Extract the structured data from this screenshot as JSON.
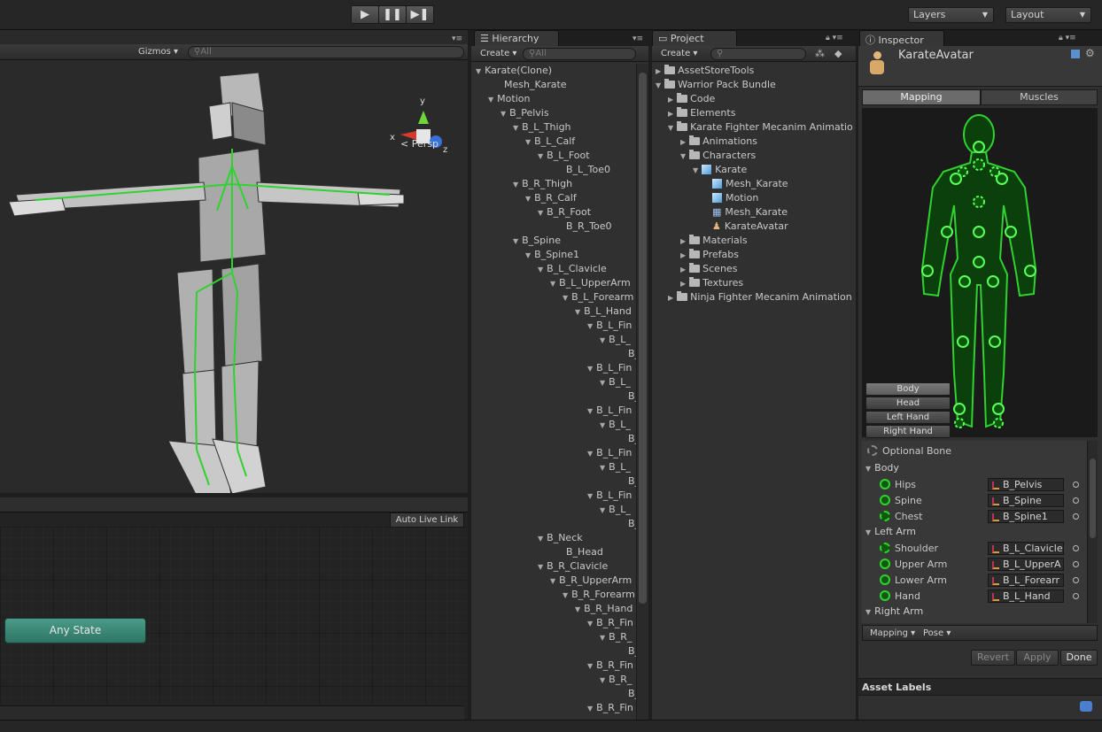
{
  "toolbar": {
    "play_icon": "play-icon",
    "pause_icon": "pause-icon",
    "step_icon": "step-icon",
    "layers_label": "Layers",
    "layout_label": "Layout"
  },
  "scene": {
    "gizmos_label": "Gizmos",
    "search_placeholder": "All",
    "persp_label": "Persp",
    "axis_y": "y",
    "axis_x": "x",
    "axis_z": "z"
  },
  "animator": {
    "auto_live_link": "Auto Live Link",
    "any_state": "Any State"
  },
  "hierarchy": {
    "tab": "Hierarchy",
    "create": "Create",
    "search_placeholder": "All",
    "items": [
      {
        "label": "Karate(Clone)",
        "arrow": "▼"
      },
      {
        "label": "Mesh_Karate",
        "arrow": ""
      },
      {
        "label": "Motion",
        "arrow": "▼"
      },
      {
        "label": "B_Pelvis",
        "arrow": "▼"
      },
      {
        "label": "B_L_Thigh",
        "arrow": "▼"
      },
      {
        "label": "B_L_Calf",
        "arrow": "▼"
      },
      {
        "label": "B_L_Foot",
        "arrow": "▼"
      },
      {
        "label": "B_L_Toe0",
        "arrow": ""
      },
      {
        "label": "B_R_Thigh",
        "arrow": "▼"
      },
      {
        "label": "B_R_Calf",
        "arrow": "▼"
      },
      {
        "label": "B_R_Foot",
        "arrow": "▼"
      },
      {
        "label": "B_R_Toe0",
        "arrow": ""
      },
      {
        "label": "B_Spine",
        "arrow": "▼"
      },
      {
        "label": "B_Spine1",
        "arrow": "▼"
      },
      {
        "label": "B_L_Clavicle",
        "arrow": "▼"
      },
      {
        "label": "B_L_UpperArm",
        "arrow": "▼"
      },
      {
        "label": "B_L_Forearm",
        "arrow": "▼"
      },
      {
        "label": "B_L_Hand",
        "arrow": "▼"
      },
      {
        "label": "B_L_Fin",
        "arrow": "▼"
      },
      {
        "label": "B_L_",
        "arrow": "▼"
      },
      {
        "label": "B_",
        "arrow": ""
      },
      {
        "label": "B_L_Fin",
        "arrow": "▼"
      },
      {
        "label": "B_L_",
        "arrow": "▼"
      },
      {
        "label": "B_",
        "arrow": ""
      },
      {
        "label": "B_L_Fin",
        "arrow": "▼"
      },
      {
        "label": "B_L_",
        "arrow": "▼"
      },
      {
        "label": "B_",
        "arrow": ""
      },
      {
        "label": "B_L_Fin",
        "arrow": "▼"
      },
      {
        "label": "B_L_",
        "arrow": "▼"
      },
      {
        "label": "B_",
        "arrow": ""
      },
      {
        "label": "B_L_Fin",
        "arrow": "▼"
      },
      {
        "label": "B_L_",
        "arrow": "▼"
      },
      {
        "label": "B_",
        "arrow": ""
      },
      {
        "label": "B_Neck",
        "arrow": "▼"
      },
      {
        "label": "B_Head",
        "arrow": ""
      },
      {
        "label": "B_R_Clavicle",
        "arrow": "▼"
      },
      {
        "label": "B_R_UpperArm",
        "arrow": "▼"
      },
      {
        "label": "B_R_Forearm",
        "arrow": "▼"
      },
      {
        "label": "B_R_Hand",
        "arrow": "▼"
      },
      {
        "label": "B_R_Fin",
        "arrow": "▼"
      },
      {
        "label": "B_R_",
        "arrow": "▼"
      },
      {
        "label": "B_",
        "arrow": ""
      },
      {
        "label": "B_R_Fin",
        "arrow": "▼"
      },
      {
        "label": "B_R_",
        "arrow": "▼"
      },
      {
        "label": "B_",
        "arrow": ""
      },
      {
        "label": "B_R_Fin",
        "arrow": "▼"
      }
    ]
  },
  "project": {
    "tab": "Project",
    "create": "Create",
    "items": [
      {
        "label": "AssetStoreTools",
        "arrow": "▶",
        "icon": "folder"
      },
      {
        "label": "Warrior Pack Bundle",
        "arrow": "▼",
        "icon": "folder"
      },
      {
        "label": "Code",
        "arrow": "▶",
        "icon": "folder"
      },
      {
        "label": "Elements",
        "arrow": "▶",
        "icon": "folder"
      },
      {
        "label": "Karate Fighter Mecanim Animatio",
        "arrow": "▼",
        "icon": "folder"
      },
      {
        "label": "Animations",
        "arrow": "▶",
        "icon": "folder"
      },
      {
        "label": "Characters",
        "arrow": "▼",
        "icon": "folder"
      },
      {
        "label": "Karate",
        "arrow": "▼",
        "icon": "model"
      },
      {
        "label": "Mesh_Karate",
        "arrow": "",
        "icon": "mesh"
      },
      {
        "label": "Motion",
        "arrow": "",
        "icon": "mesh"
      },
      {
        "label": "Mesh_Karate",
        "arrow": "",
        "icon": "grid"
      },
      {
        "label": "KarateAvatar",
        "arrow": "",
        "icon": "avatar"
      },
      {
        "label": "Materials",
        "arrow": "▶",
        "icon": "folder"
      },
      {
        "label": "Prefabs",
        "arrow": "▶",
        "icon": "folder"
      },
      {
        "label": "Scenes",
        "arrow": "▶",
        "icon": "folder"
      },
      {
        "label": "Textures",
        "arrow": "▶",
        "icon": "folder"
      },
      {
        "label": "Ninja Fighter Mecanim Animation",
        "arrow": "▶",
        "icon": "folder"
      }
    ]
  },
  "inspector": {
    "tab": "Inspector",
    "asset_name": "KarateAvatar",
    "mapping_tab": "Mapping",
    "muscles_tab": "Muscles",
    "part_buttons": [
      "Body",
      "Head",
      "Left Hand",
      "Right Hand"
    ],
    "optional_bone": "Optional Bone",
    "body_section": "Body",
    "body_bones": [
      {
        "name": "Hips",
        "value": "B_Pelvis",
        "dashed": false
      },
      {
        "name": "Spine",
        "value": "B_Spine",
        "dashed": false
      },
      {
        "name": "Chest",
        "value": "B_Spine1",
        "dashed": true
      }
    ],
    "left_arm_section": "Left Arm",
    "left_arm_bones": [
      {
        "name": "Shoulder",
        "value": "B_L_Clavicle",
        "dashed": true
      },
      {
        "name": "Upper Arm",
        "value": "B_L_UpperA",
        "dashed": false
      },
      {
        "name": "Lower Arm",
        "value": "B_L_Forearr",
        "dashed": false
      },
      {
        "name": "Hand",
        "value": "B_L_Hand",
        "dashed": false
      }
    ],
    "right_arm_section": "Right Arm",
    "mapping_dropdown": "Mapping",
    "pose_dropdown": "Pose",
    "revert": "Revert",
    "apply": "Apply",
    "done": "Done",
    "asset_labels": "Asset Labels"
  },
  "colors": {
    "bone_green": "#2fd22f",
    "body_green": "#0b3f0b",
    "any_state": "#3d8a78"
  }
}
